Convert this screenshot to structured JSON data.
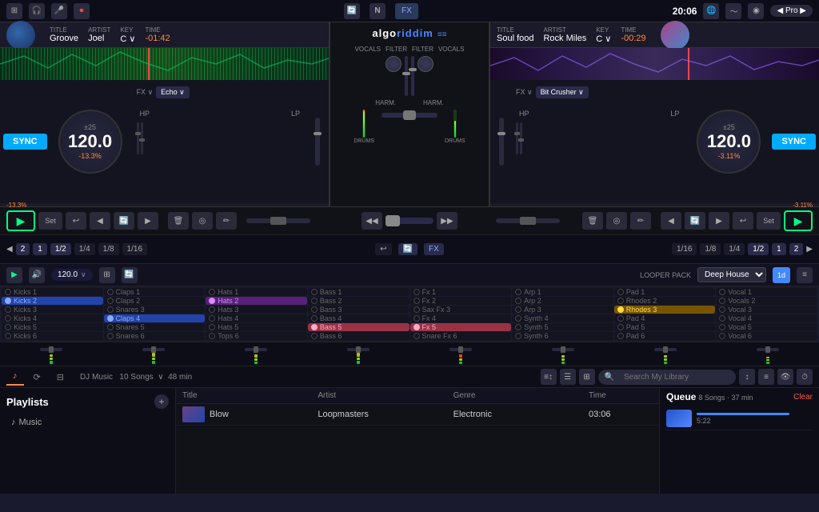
{
  "topbar": {
    "time": "20:06",
    "pro_label": "◀ Pro ▶",
    "fx_label": "FX"
  },
  "deck_left": {
    "title_label": "TITLE",
    "title": "Groove",
    "artist_label": "ARTIST",
    "artist": "Joel",
    "key_label": "KEY",
    "key": "C ∨",
    "time_label": "TIME",
    "time": "-01:42",
    "bpm_range": "±25",
    "bpm": "120.0",
    "bpm_percent": "-13.3%",
    "fx_name": "Echo ∨",
    "hp": "HP",
    "lp": "LP",
    "sync_label": "SYNC"
  },
  "deck_right": {
    "title_label": "TITLE",
    "title": "Soul food",
    "artist_label": "ARTIST",
    "artist": "Rock Miles",
    "key_label": "KEY",
    "key": "C ∨",
    "time_label": "TIME",
    "time": "-00:29",
    "bpm_range": "±25",
    "bpm": "120.0",
    "bpm_percent": "-3.11%",
    "fx_name": "Bit Crusher ∨",
    "hp": "HP",
    "lp": "LP",
    "sync_label": "SYNC"
  },
  "mixer": {
    "logo": "algoriddim",
    "logo_symbol": "▶▶",
    "vocals_label": "VOCALS",
    "filter_label": "FILTER",
    "harm_label": "HARM.",
    "drums_label": "DRUMS"
  },
  "transport_left": {
    "play": "▶",
    "set": "Set"
  },
  "transport_right": {
    "play": "▶",
    "set": "Set"
  },
  "loop_values": [
    "2",
    "1",
    "1/2",
    "1/4",
    "1/8",
    "1/16"
  ],
  "sampler": {
    "bpm": "120.0",
    "looper_pack_label": "LOOPER PACK",
    "looper_pack": "Deep House",
    "grid_label": "1d",
    "cells": [
      {
        "name": "Kicks 1",
        "state": "empty"
      },
      {
        "name": "Claps 1",
        "state": "empty"
      },
      {
        "name": "Hats 1",
        "state": "empty"
      },
      {
        "name": "Bass 1",
        "state": "empty"
      },
      {
        "name": "Fx 1",
        "state": "empty"
      },
      {
        "name": "Arp 1",
        "state": "empty"
      },
      {
        "name": "Pad 1",
        "state": "empty"
      },
      {
        "name": "Vocal 1",
        "state": "empty"
      },
      {
        "name": "Kicks 2",
        "state": "active-blue"
      },
      {
        "name": "Claps 2",
        "state": "empty"
      },
      {
        "name": "Hats 2",
        "state": "active-purple"
      },
      {
        "name": "Bass 2",
        "state": "empty"
      },
      {
        "name": "Fx 2",
        "state": "empty"
      },
      {
        "name": "Arp 2",
        "state": "empty"
      },
      {
        "name": "Rhodes 2",
        "state": "empty"
      },
      {
        "name": "Vocals 2",
        "state": "empty"
      },
      {
        "name": "Kicks 3",
        "state": "empty"
      },
      {
        "name": "Snares 3",
        "state": "empty"
      },
      {
        "name": "Hats 3",
        "state": "empty"
      },
      {
        "name": "Bass 3",
        "state": "empty"
      },
      {
        "name": "Sax Fx 3",
        "state": "empty"
      },
      {
        "name": "Arp 3",
        "state": "empty"
      },
      {
        "name": "Rhodes 3",
        "state": "active-yellow"
      },
      {
        "name": "Vocal 3",
        "state": "empty"
      },
      {
        "name": "Kicks 4",
        "state": "empty"
      },
      {
        "name": "Claps 4",
        "state": "active-blue"
      },
      {
        "name": "Hats 4",
        "state": "empty"
      },
      {
        "name": "Bass 4",
        "state": "empty"
      },
      {
        "name": "Fx 4",
        "state": "empty"
      },
      {
        "name": "Synth 4",
        "state": "empty"
      },
      {
        "name": "Pad 4",
        "state": "empty"
      },
      {
        "name": "Vocal 4",
        "state": "empty"
      },
      {
        "name": "Kicks 5",
        "state": "empty"
      },
      {
        "name": "Snares 5",
        "state": "empty"
      },
      {
        "name": "Hats 5",
        "state": "empty"
      },
      {
        "name": "Bass 5",
        "state": "active-pink"
      },
      {
        "name": "Fx 5",
        "state": "active-pink"
      },
      {
        "name": "Synth 5",
        "state": "empty"
      },
      {
        "name": "Pad 5",
        "state": "empty"
      },
      {
        "name": "Vocal 5",
        "state": "empty"
      },
      {
        "name": "Kicks 6",
        "state": "empty"
      },
      {
        "name": "Snares 6",
        "state": "empty"
      },
      {
        "name": "Tops 6",
        "state": "empty"
      },
      {
        "name": "Bass 6",
        "state": "empty"
      },
      {
        "name": "Snare Fx 6",
        "state": "empty"
      },
      {
        "name": "Synth 6",
        "state": "empty"
      },
      {
        "name": "Pad 6",
        "state": "empty"
      },
      {
        "name": "Vocal 6",
        "state": "empty"
      }
    ]
  },
  "library": {
    "tabs": [
      {
        "label": "♪",
        "active": true
      },
      {
        "label": "⟳",
        "active": false
      },
      {
        "label": "⊞",
        "active": false
      }
    ],
    "collection_name": "DJ Music",
    "song_count": "10 Songs",
    "duration": "48 min",
    "search_placeholder": "Search My Library",
    "columns": [
      "Title",
      "Artist",
      "Genre",
      "Time"
    ],
    "tracks": [
      {
        "title": "Blow",
        "artist": "Loopmasters",
        "genre": "Electronic",
        "time": "03:06"
      }
    ],
    "sidebar_title": "Playlists",
    "add_btn": "+",
    "sidebar_items": [
      {
        "label": "Music",
        "active": false
      }
    ]
  },
  "queue": {
    "title": "Queue",
    "count": "8 Songs",
    "duration": "37 min",
    "clear_label": "Clear",
    "tracks": [
      {
        "color": "#4488ff"
      }
    ]
  }
}
